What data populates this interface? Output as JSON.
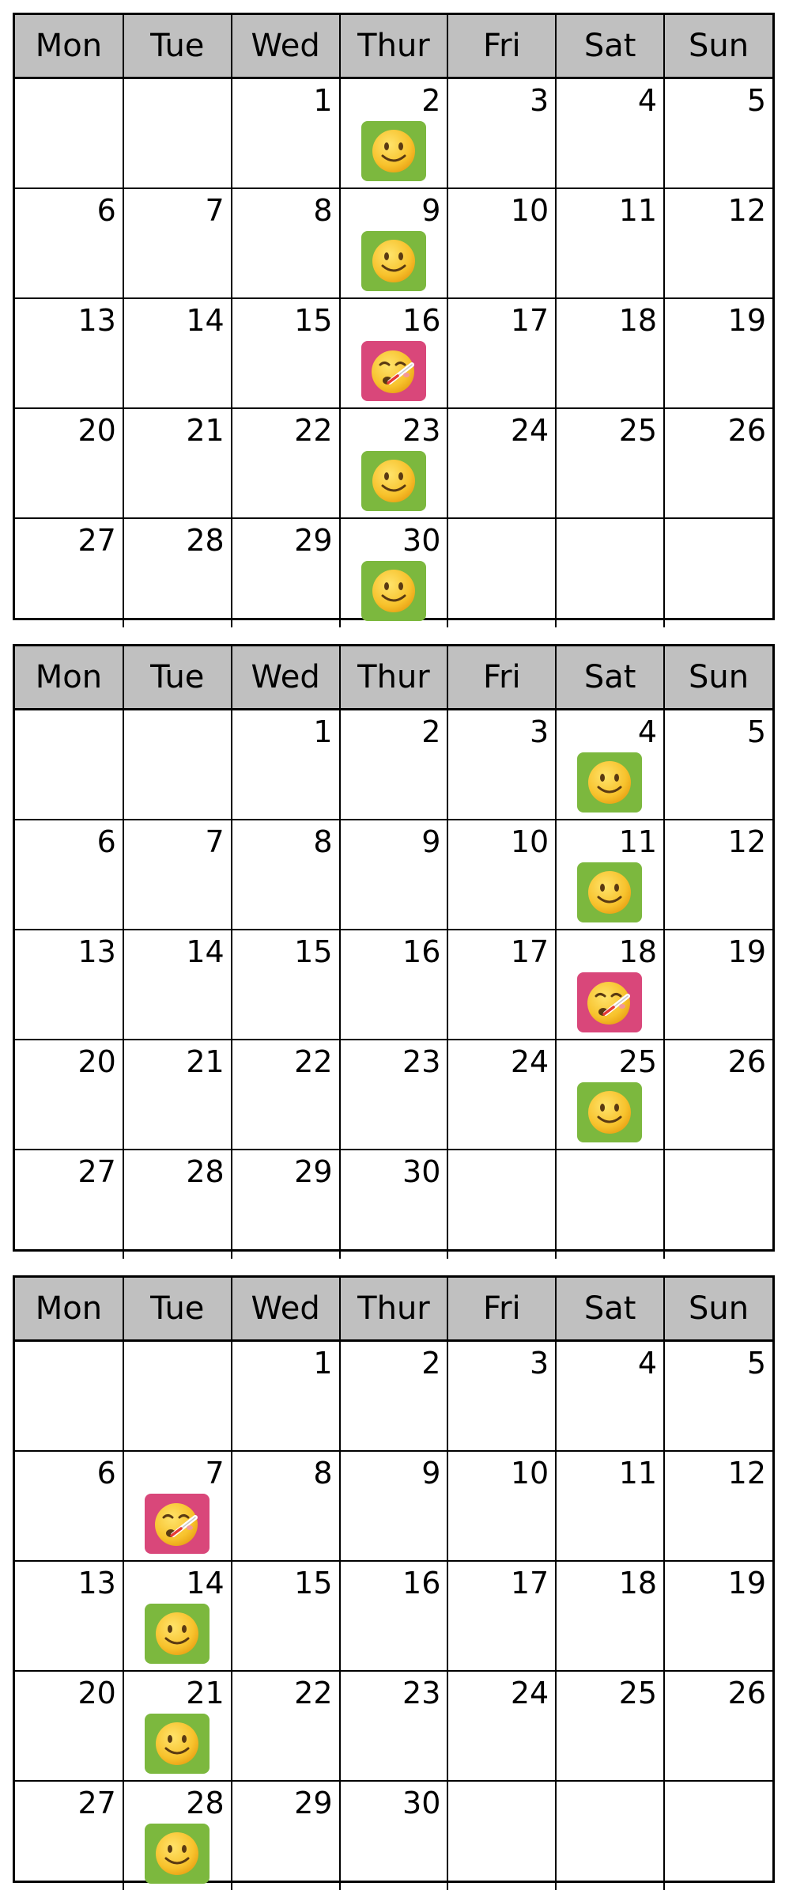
{
  "colors": {
    "header_bg": "#c0c0c0",
    "happy_bg": "#7cb83e",
    "sick_bg": "#d9477a"
  },
  "calendars": [
    {
      "weekdays": [
        "Mon",
        "Tue",
        "Wed",
        "Thur",
        "Fri",
        "Sat",
        "Sun"
      ],
      "weeks": [
        [
          {
            "day": ""
          },
          {
            "day": ""
          },
          {
            "day": "1"
          },
          {
            "day": "2",
            "mood": "smiling-face-icon"
          },
          {
            "day": "3"
          },
          {
            "day": "4"
          },
          {
            "day": "5"
          }
        ],
        [
          {
            "day": "6"
          },
          {
            "day": "7"
          },
          {
            "day": "8"
          },
          {
            "day": "9",
            "mood": "smiling-face-icon"
          },
          {
            "day": "10"
          },
          {
            "day": "11"
          },
          {
            "day": "12"
          }
        ],
        [
          {
            "day": "13"
          },
          {
            "day": "14"
          },
          {
            "day": "15"
          },
          {
            "day": "16",
            "mood": "thermometer-face-icon"
          },
          {
            "day": "17"
          },
          {
            "day": "18"
          },
          {
            "day": "19"
          }
        ],
        [
          {
            "day": "20"
          },
          {
            "day": "21"
          },
          {
            "day": "22"
          },
          {
            "day": "23",
            "mood": "smiling-face-icon"
          },
          {
            "day": "24"
          },
          {
            "day": "25"
          },
          {
            "day": "26"
          }
        ],
        [
          {
            "day": "27"
          },
          {
            "day": "28"
          },
          {
            "day": "29"
          },
          {
            "day": "30",
            "mood": "smiling-face-icon"
          },
          {
            "day": ""
          },
          {
            "day": ""
          },
          {
            "day": ""
          }
        ]
      ]
    },
    {
      "weekdays": [
        "Mon",
        "Tue",
        "Wed",
        "Thur",
        "Fri",
        "Sat",
        "Sun"
      ],
      "weeks": [
        [
          {
            "day": ""
          },
          {
            "day": ""
          },
          {
            "day": "1"
          },
          {
            "day": "2"
          },
          {
            "day": "3"
          },
          {
            "day": "4",
            "mood": "smiling-face-icon"
          },
          {
            "day": "5"
          }
        ],
        [
          {
            "day": "6"
          },
          {
            "day": "7"
          },
          {
            "day": "8"
          },
          {
            "day": "9"
          },
          {
            "day": "10"
          },
          {
            "day": "11",
            "mood": "smiling-face-icon"
          },
          {
            "day": "12"
          }
        ],
        [
          {
            "day": "13"
          },
          {
            "day": "14"
          },
          {
            "day": "15"
          },
          {
            "day": "16"
          },
          {
            "day": "17"
          },
          {
            "day": "18",
            "mood": "thermometer-face-icon"
          },
          {
            "day": "19"
          }
        ],
        [
          {
            "day": "20"
          },
          {
            "day": "21"
          },
          {
            "day": "22"
          },
          {
            "day": "23"
          },
          {
            "day": "24"
          },
          {
            "day": "25",
            "mood": "smiling-face-icon"
          },
          {
            "day": "26"
          }
        ],
        [
          {
            "day": "27"
          },
          {
            "day": "28"
          },
          {
            "day": "29"
          },
          {
            "day": "30"
          },
          {
            "day": ""
          },
          {
            "day": ""
          },
          {
            "day": ""
          }
        ]
      ]
    },
    {
      "weekdays": [
        "Mon",
        "Tue",
        "Wed",
        "Thur",
        "Fri",
        "Sat",
        "Sun"
      ],
      "weeks": [
        [
          {
            "day": ""
          },
          {
            "day": ""
          },
          {
            "day": "1"
          },
          {
            "day": "2"
          },
          {
            "day": "3"
          },
          {
            "day": "4"
          },
          {
            "day": "5"
          }
        ],
        [
          {
            "day": "6"
          },
          {
            "day": "7",
            "mood": "thermometer-face-icon"
          },
          {
            "day": "8"
          },
          {
            "day": "9"
          },
          {
            "day": "10"
          },
          {
            "day": "11"
          },
          {
            "day": "12"
          }
        ],
        [
          {
            "day": "13"
          },
          {
            "day": "14",
            "mood": "smiling-face-icon"
          },
          {
            "day": "15"
          },
          {
            "day": "16"
          },
          {
            "day": "17"
          },
          {
            "day": "18"
          },
          {
            "day": "19"
          }
        ],
        [
          {
            "day": "20"
          },
          {
            "day": "21",
            "mood": "smiling-face-icon"
          },
          {
            "day": "22"
          },
          {
            "day": "23"
          },
          {
            "day": "24"
          },
          {
            "day": "25"
          },
          {
            "day": "26"
          }
        ],
        [
          {
            "day": "27"
          },
          {
            "day": "28",
            "mood": "smiling-face-icon"
          },
          {
            "day": "29"
          },
          {
            "day": "30"
          },
          {
            "day": ""
          },
          {
            "day": ""
          },
          {
            "day": ""
          }
        ]
      ]
    }
  ]
}
